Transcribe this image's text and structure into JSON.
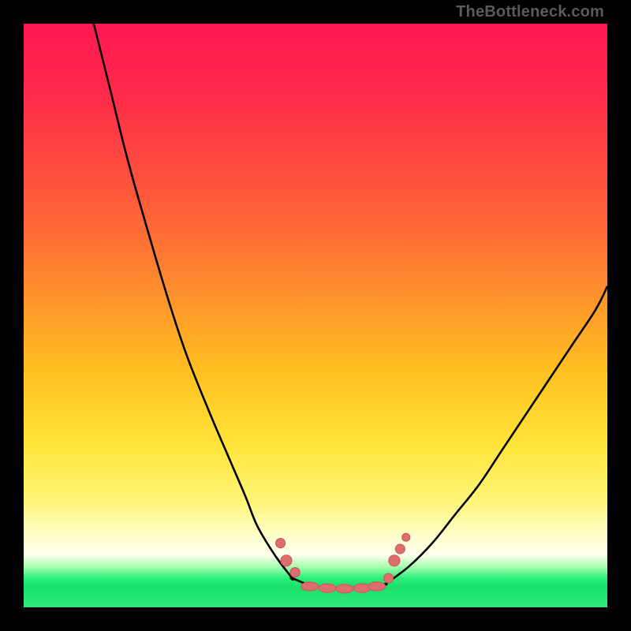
{
  "attribution": "TheBottleneck.com",
  "colors": {
    "page_bg": "#000000",
    "gradient_top": "#ff1850",
    "gradient_mid": "#ffc221",
    "gradient_low": "#ffffee",
    "gradient_green": "#25e572",
    "curve": "#000000",
    "dot": "#de6e6e"
  },
  "chart_data": {
    "type": "line",
    "title": "",
    "xlabel": "",
    "ylabel": "",
    "xlim": [
      0,
      100
    ],
    "ylim": [
      0,
      100
    ],
    "grid": false,
    "legend": false,
    "series": [
      {
        "name": "left-branch",
        "x": [
          12,
          15,
          18,
          22,
          25,
          28,
          32,
          35,
          38,
          40,
          43,
          46
        ],
        "y": [
          100,
          88,
          76,
          62,
          52,
          43,
          33,
          26,
          19,
          14,
          9,
          5
        ]
      },
      {
        "name": "valley-floor",
        "x": [
          46,
          50,
          54,
          58,
          62
        ],
        "y": [
          5,
          3.5,
          3.2,
          3.3,
          4
        ]
      },
      {
        "name": "right-branch",
        "x": [
          62,
          66,
          70,
          74,
          78,
          82,
          86,
          90,
          94,
          98,
          100
        ],
        "y": [
          4,
          7,
          11,
          16,
          21,
          27,
          33,
          39,
          45,
          51,
          55
        ]
      }
    ],
    "markers": [
      {
        "name": "left-cluster",
        "x": 44,
        "y": 11,
        "r": 6
      },
      {
        "name": "left-cluster",
        "x": 45,
        "y": 8,
        "r": 7
      },
      {
        "name": "left-cluster",
        "x": 46.5,
        "y": 6,
        "r": 6
      },
      {
        "name": "flat-a",
        "x": 49,
        "y": 3.6,
        "r": 5
      },
      {
        "name": "flat-b",
        "x": 52,
        "y": 3.3,
        "r": 5
      },
      {
        "name": "flat-c",
        "x": 55,
        "y": 3.2,
        "r": 5
      },
      {
        "name": "flat-d",
        "x": 58,
        "y": 3.3,
        "r": 5
      },
      {
        "name": "flat-e",
        "x": 60.5,
        "y": 3.6,
        "r": 5
      },
      {
        "name": "right-cluster",
        "x": 62.5,
        "y": 5,
        "r": 6
      },
      {
        "name": "right-cluster",
        "x": 63.5,
        "y": 8,
        "r": 7
      },
      {
        "name": "right-cluster",
        "x": 64.5,
        "y": 10,
        "r": 6
      },
      {
        "name": "right-cluster",
        "x": 65.5,
        "y": 12,
        "r": 5
      }
    ]
  }
}
